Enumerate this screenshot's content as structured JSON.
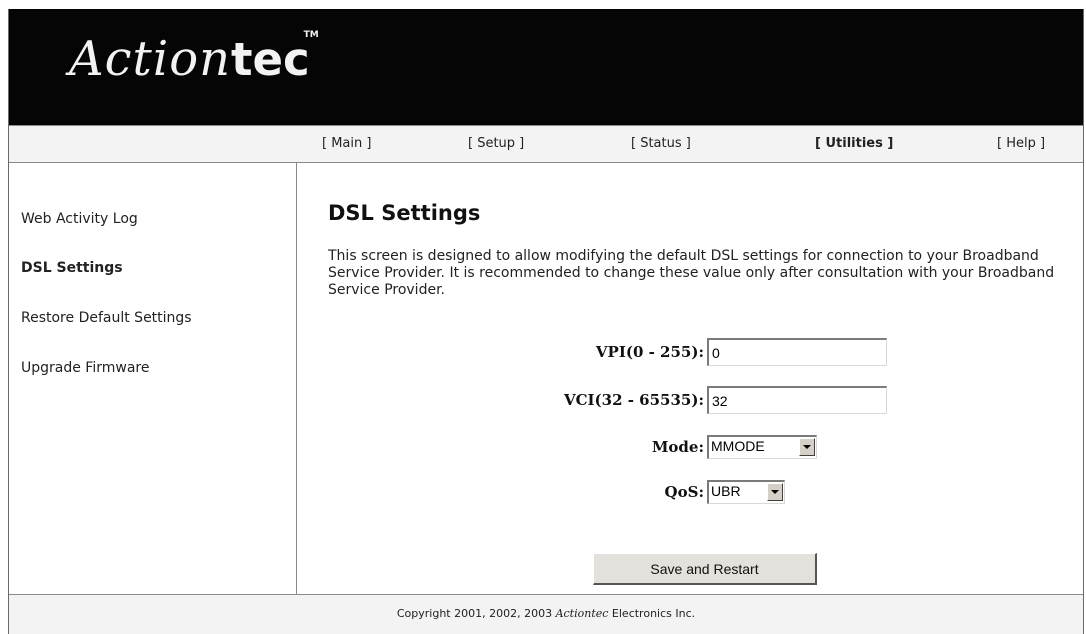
{
  "header": {
    "logo_script": "Action",
    "logo_bold": "tec",
    "logo_tm": "TM"
  },
  "nav": {
    "items": [
      {
        "label": "[ Main ]",
        "active": false
      },
      {
        "label": "[ Setup ]",
        "active": false
      },
      {
        "label": "[ Status ]",
        "active": false
      },
      {
        "label": "[ Utilities ]",
        "active": true
      },
      {
        "label": "[ Help ]",
        "active": false
      }
    ]
  },
  "sidebar": {
    "items": [
      {
        "label": "Web Activity Log",
        "active": false
      },
      {
        "label": "DSL Settings",
        "active": true
      },
      {
        "label": "Restore Default Settings",
        "active": false
      },
      {
        "label": "Upgrade Firmware",
        "active": false
      }
    ]
  },
  "main": {
    "title": "DSL Settings",
    "description": "This screen is designed to allow modifying the default DSL settings for connection to your Broadband Service Provider. It is recommended to change these value only after consultation with your Broadband Service Provider.",
    "vpi": {
      "label": "VPI(0 - 255):",
      "value": "0"
    },
    "vci": {
      "label": "VCI(32 - 65535):",
      "value": "32"
    },
    "mode": {
      "label": "Mode:",
      "value": "MMODE"
    },
    "qos": {
      "label": "QoS:",
      "value": "UBR"
    },
    "save_button": "Save and Restart"
  },
  "footer": {
    "prefix": "Copyright 2001, 2002, 2003 ",
    "brand": "Actiontec",
    "suffix": " Electronics Inc."
  }
}
